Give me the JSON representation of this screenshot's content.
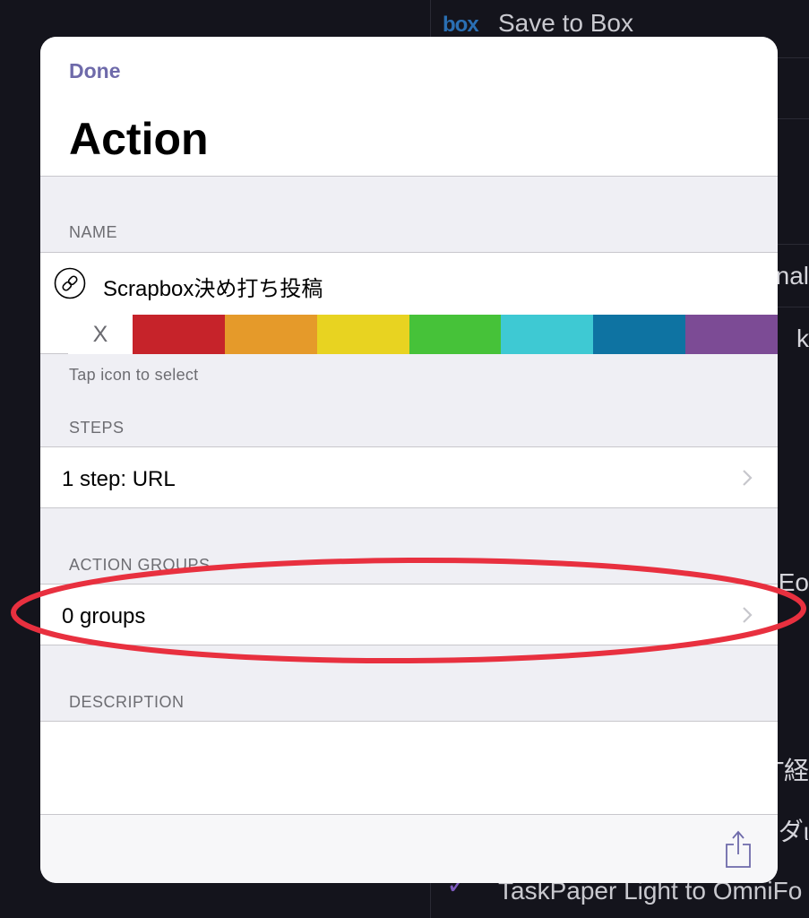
{
  "background": {
    "rows": [
      {
        "text": "Save to Box",
        "icon": "box-logo-icon"
      },
      {
        "text": "nal"
      },
      {
        "text": "k"
      },
      {
        "text": "Eo"
      },
      {
        "text": "T経"
      },
      {
        "text": "ダι"
      },
      {
        "text": "TaskPaper Light to OmniFo",
        "icon": "checkmark-icon"
      }
    ],
    "box_logo_text": "box"
  },
  "modal": {
    "done_label": "Done",
    "title": "Action",
    "name_section": {
      "header": "NAME",
      "icon": "link-icon",
      "value": "Scrapbox決め打ち投稿",
      "clear_label": "X",
      "colors": [
        "#c6232a",
        "#e59a2a",
        "#e8d321",
        "#46c239",
        "#3ec9d3",
        "#0e73a2",
        "#7c4b95"
      ],
      "hint": "Tap icon to select"
    },
    "steps_section": {
      "header": "STEPS",
      "value": "1 step: URL"
    },
    "groups_section": {
      "header": "ACTION GROUPS",
      "value": "0 groups"
    },
    "description_section": {
      "header": "DESCRIPTION",
      "value": ""
    },
    "toolbar": {
      "share_icon": "share-icon"
    }
  },
  "annotation_color": "#e8303f"
}
